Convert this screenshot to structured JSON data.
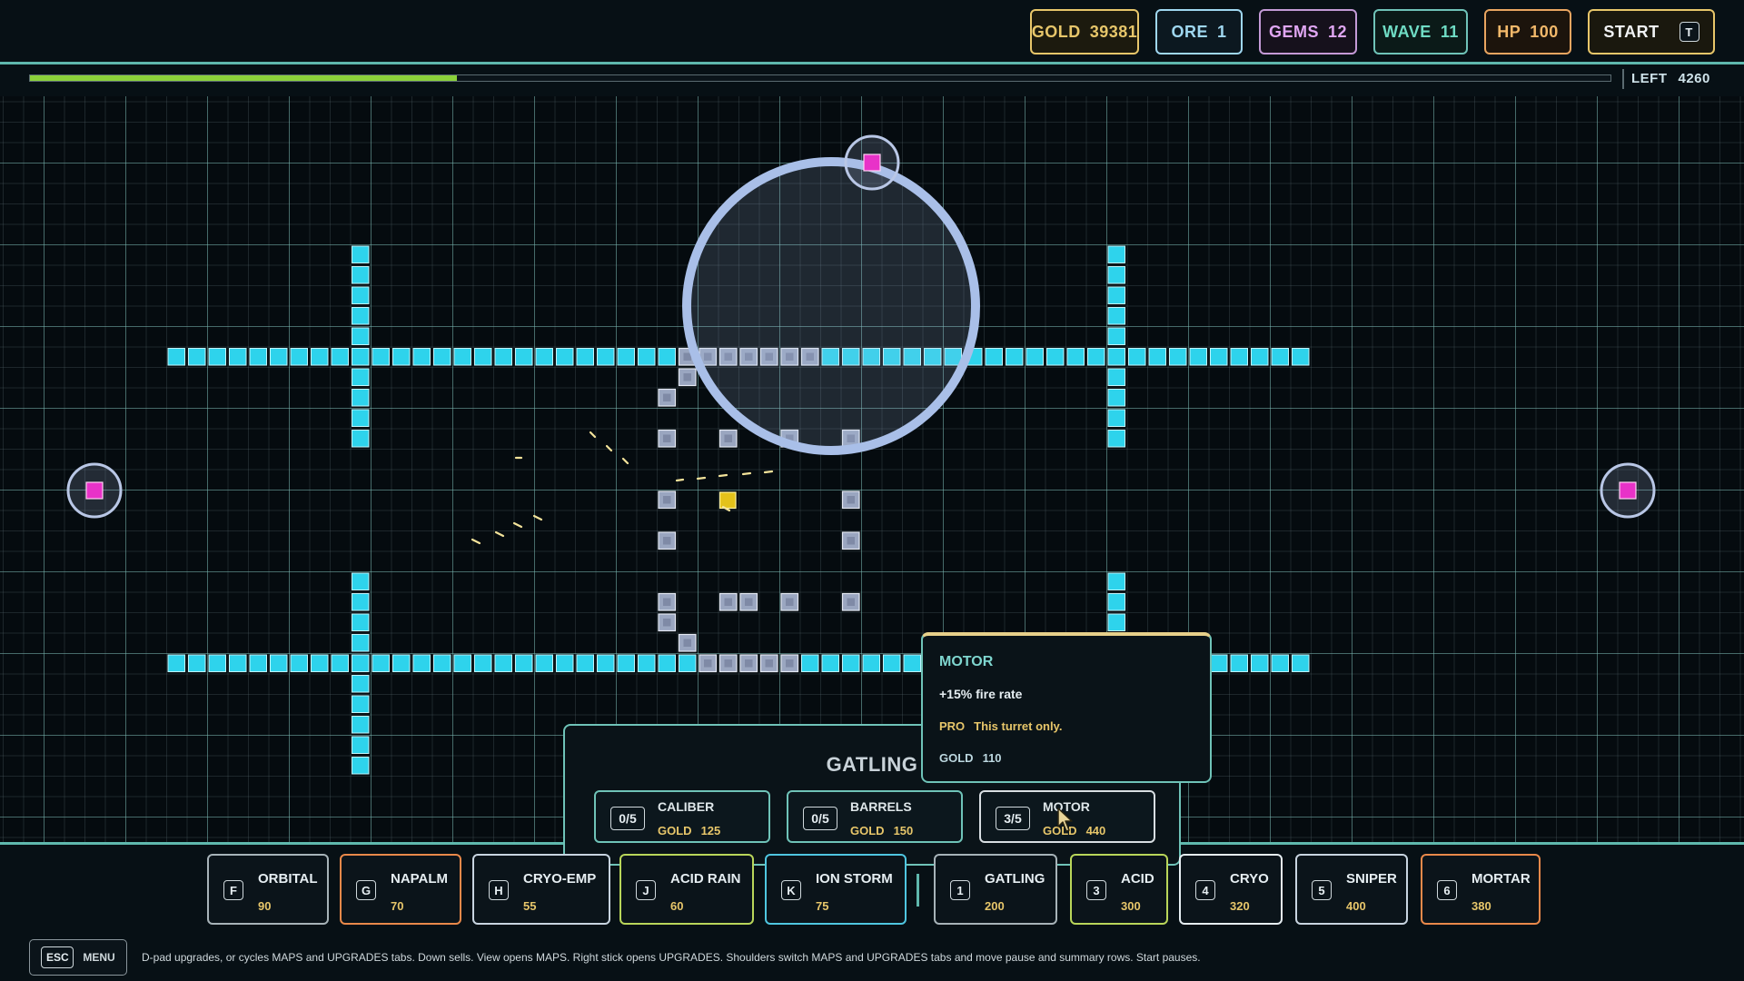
{
  "hud": {
    "stats": [
      {
        "id": "gold",
        "label": "GOLD",
        "value": "39381",
        "color": "#e7c66a",
        "border": "#e7c66a",
        "bg": "#1c1a0e"
      },
      {
        "id": "ore",
        "label": "ORE",
        "value": "1",
        "color": "#9fd7f0",
        "border": "#9fd7f0",
        "bg": "#0c1820"
      },
      {
        "id": "gems",
        "label": "GEMS",
        "value": "12",
        "color": "#e0a6f2",
        "border": "#c49ad6",
        "bg": "#16111c"
      },
      {
        "id": "wave",
        "label": "WAVE",
        "value": "11",
        "color": "#6fdcc4",
        "border": "#6fc3b8",
        "bg": "#0b1a18"
      },
      {
        "id": "hp",
        "label": "HP",
        "value": "100",
        "color": "#f2b86a",
        "border": "#e9a560",
        "bg": "#1c140c"
      }
    ],
    "start": {
      "label": "START",
      "key": "T"
    },
    "wave_progress": 0.27,
    "left": {
      "label": "LEFT",
      "value": "4260"
    }
  },
  "upgrade_panel": {
    "turret": "GATLING",
    "upgrades": [
      {
        "name": "CALIBER",
        "level": "0/5",
        "cost_label": "GOLD",
        "cost": "125"
      },
      {
        "name": "BARRELS",
        "level": "0/5",
        "cost_label": "GOLD",
        "cost": "150"
      },
      {
        "name": "MOTOR",
        "level": "3/5",
        "cost_label": "GOLD",
        "cost": "440"
      }
    ]
  },
  "tooltip": {
    "title": "MOTOR",
    "effect": "+15% fire rate",
    "pro_tag": "PRO",
    "pro_text": "This turret only.",
    "cost_label": "GOLD",
    "cost": "110"
  },
  "toolbar": {
    "abilities": [
      {
        "key": "F",
        "name": "ORBITAL",
        "cost": "90",
        "color": "#a7b3b8"
      },
      {
        "key": "G",
        "name": "NAPALM",
        "cost": "70",
        "color": "#e9894a"
      },
      {
        "key": "H",
        "name": "CRYO-EMP",
        "cost": "55",
        "color": "#c8d4e0"
      },
      {
        "key": "J",
        "name": "ACID RAIN",
        "cost": "60",
        "color": "#b9d65a"
      },
      {
        "key": "K",
        "name": "ION STORM",
        "cost": "75",
        "color": "#4fc6e0"
      }
    ],
    "turrets": [
      {
        "key": "1",
        "name": "GATLING",
        "cost": "200",
        "color": "#a7b3b8"
      },
      {
        "key": "3",
        "name": "ACID",
        "cost": "300",
        "color": "#b9d65a"
      },
      {
        "key": "4",
        "name": "CRYO",
        "cost": "320",
        "color": "#e6eef2"
      },
      {
        "key": "5",
        "name": "SNIPER",
        "cost": "400",
        "color": "#c8d4e0"
      },
      {
        "key": "6",
        "name": "MORTAR",
        "cost": "380",
        "color": "#e9894a"
      }
    ]
  },
  "footer": {
    "esc_key": "ESC",
    "menu_label": "MENU",
    "help": "D-pad upgrades, or cycles MAPS and UPGRADES tabs. Down sells. View opens MAPS. Right stick opens UPGRADES. Shoulders switch MAPS and UPGRADES tabs and move pause and summary rows. Start pauses."
  },
  "colors": {
    "path": "#2ed3ec",
    "turret": "#9aa6c0",
    "spawner": "#e832c8",
    "core": "#e4c21a",
    "range": "#a9bfe8",
    "accent": "#6fc3b8"
  }
}
